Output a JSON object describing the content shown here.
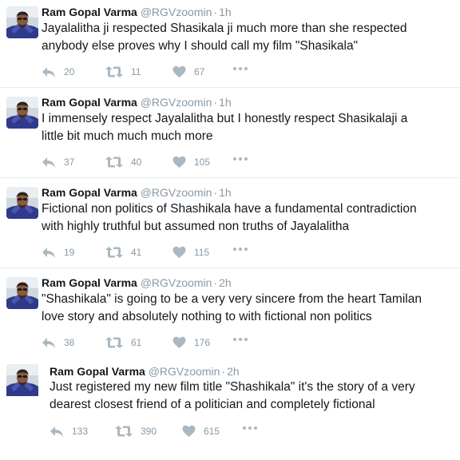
{
  "colors": {
    "icon": "#aab8c2",
    "muted": "#8899a6",
    "text": "#14171a",
    "separator": "#e6ecf0"
  },
  "tweets": [
    {
      "name": "Ram Gopal Varma",
      "handle": "@RGVzoomin",
      "separator": "·",
      "time": "1h",
      "lines": [
        "Jayalalitha ji respected Shasikala ji much more than she respected",
        "anybody else proves why I should call my film \"Shasikala\""
      ],
      "replies": "20",
      "retweets": "11",
      "likes": "67"
    },
    {
      "name": "Ram Gopal Varma",
      "handle": "@RGVzoomin",
      "separator": "·",
      "time": "1h",
      "lines": [
        "I immensely respect Jayalalitha but I honestly respect Shasikalaji a",
        "little bit much much much more"
      ],
      "replies": "37",
      "retweets": "40",
      "likes": "105"
    },
    {
      "name": "Ram Gopal Varma",
      "handle": "@RGVzoomin",
      "separator": "·",
      "time": "1h",
      "lines": [
        "Fictional non politics of Shashikala have a fundamental contradiction",
        "with highly truthful but assumed non truths of Jayalalitha"
      ],
      "replies": "19",
      "retweets": "41",
      "likes": "115"
    },
    {
      "name": "Ram Gopal Varma",
      "handle": "@RGVzoomin",
      "separator": "·",
      "time": "2h",
      "lines": [
        "\"Shashikala\" is going to be a very very sincere from the heart Tamilan",
        "love story and absolutely nothing to with fictional non politics"
      ],
      "replies": "38",
      "retweets": "61",
      "likes": "176"
    },
    {
      "name": "Ram Gopal Varma",
      "handle": "@RGVzoomin",
      "separator": "·",
      "time": "2h",
      "lines": [
        "Just registered my new film title \"Shashikala\"  it's the story of a very",
        "dearest closest friend of a politician and completely fictional"
      ],
      "replies": "133",
      "retweets": "390",
      "likes": "615"
    }
  ]
}
